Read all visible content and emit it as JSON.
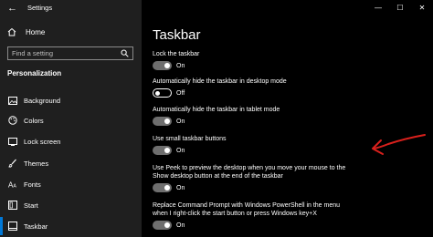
{
  "window": {
    "title": "Settings",
    "controls": {
      "minimize": "—",
      "maximize": "☐",
      "close": "✕"
    }
  },
  "sidebar": {
    "home_label": "Home",
    "search_placeholder": "Find a setting",
    "section_header": "Personalization",
    "items": [
      {
        "label": "Background",
        "icon": "image-icon"
      },
      {
        "label": "Colors",
        "icon": "palette-icon"
      },
      {
        "label": "Lock screen",
        "icon": "lock-screen-icon"
      },
      {
        "label": "Themes",
        "icon": "brush-icon"
      },
      {
        "label": "Fonts",
        "icon": "font-icon"
      },
      {
        "label": "Start",
        "icon": "start-icon"
      },
      {
        "label": "Taskbar",
        "icon": "taskbar-icon",
        "selected": true
      }
    ]
  },
  "main": {
    "title": "Taskbar",
    "settings": [
      {
        "label": "Lock the taskbar",
        "state": "On",
        "on": true
      },
      {
        "label": "Automatically hide the taskbar in desktop mode",
        "state": "Off",
        "on": false
      },
      {
        "label": "Automatically hide the taskbar in tablet mode",
        "state": "On",
        "on": true
      },
      {
        "label": "Use small taskbar buttons",
        "state": "On",
        "on": true
      },
      {
        "label": "Use Peek to preview the desktop when you move your mouse to the\nShow desktop button at the end of the taskbar",
        "state": "On",
        "on": true
      },
      {
        "label": "Replace Command Prompt with Windows PowerShell in the menu\nwhen I right-click the start button or press Windows key+X",
        "state": "On",
        "on": true
      }
    ]
  },
  "colors": {
    "sidebar_bg": "#1f1f1f",
    "main_bg": "#000000",
    "accent": "#0078d7",
    "annotation": "#d9201c"
  }
}
